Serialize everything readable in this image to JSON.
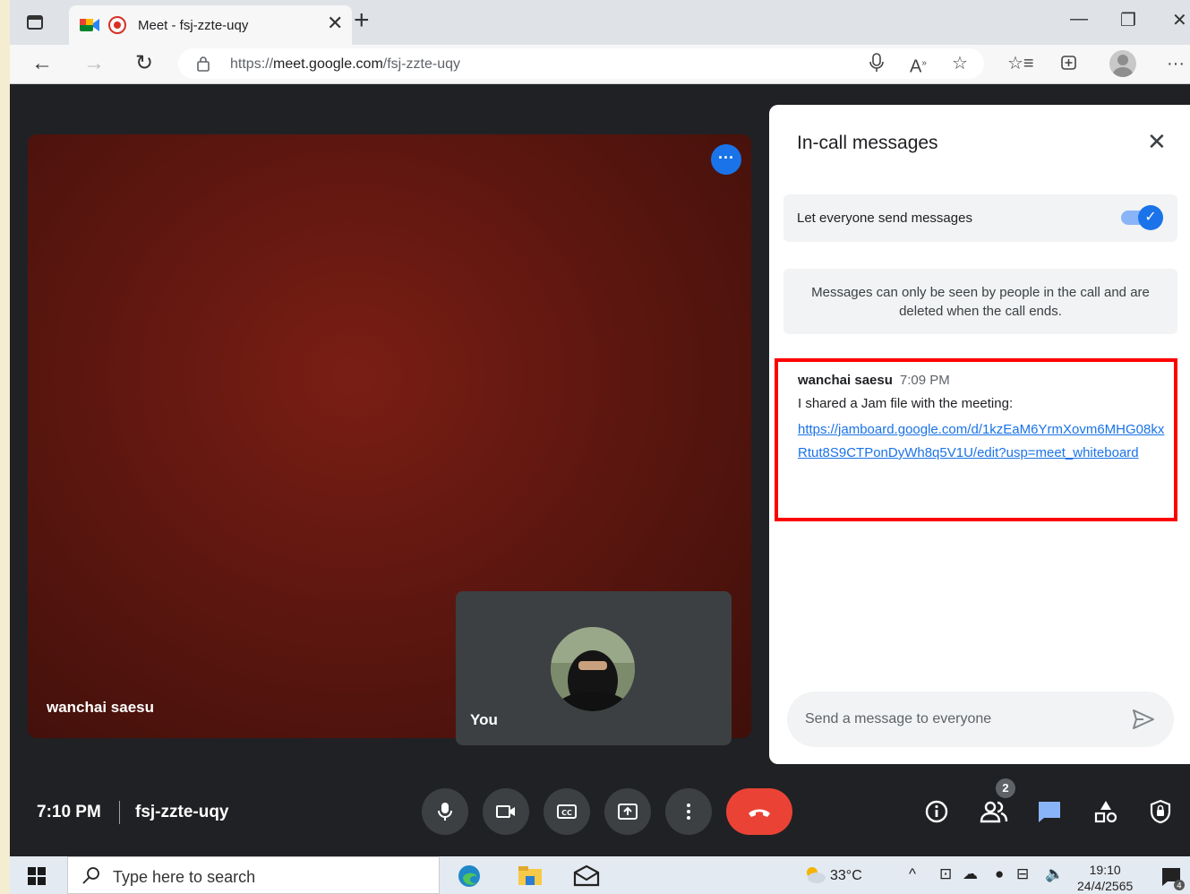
{
  "browser": {
    "tab_title": "Meet - fsj-zzte-uqy",
    "url_prefix": "https://",
    "url_domain": "meet.google.com",
    "url_path": "/fsj-zzte-uqy"
  },
  "main_tile": {
    "participant_name": "wanchai saesu"
  },
  "self_tile": {
    "label": "You"
  },
  "panel": {
    "title": "In-call messages",
    "toggle_label": "Let everyone send messages",
    "toggle_on": true,
    "info_text": "Messages can only be seen by people in the call and are deleted when the call ends.",
    "message": {
      "sender": "wanchai saesu",
      "time": "7:09 PM",
      "text": "I shared a Jam file with the meeting:",
      "link": "https://jamboard.google.com/d/1kzEaM6YrmXovm6MHG08kxRtut8S9CTPonDyWh8q5V1U/edit?usp=meet_whiteboard"
    },
    "composer_placeholder": "Send a message to everyone"
  },
  "bottom_bar": {
    "time": "7:10 PM",
    "meeting_code": "fsj-zzte-uqy",
    "people_count": "2"
  },
  "taskbar": {
    "search_placeholder": "Type here to search",
    "weather": "33°C",
    "clock_time": "19:10",
    "clock_date": "24/4/2565",
    "notification_count": "4"
  },
  "colors": {
    "meet_dark": "#202124",
    "accent_blue": "#1a73e8",
    "end_call_red": "#ea4335",
    "highlight_red": "#ff0000"
  }
}
